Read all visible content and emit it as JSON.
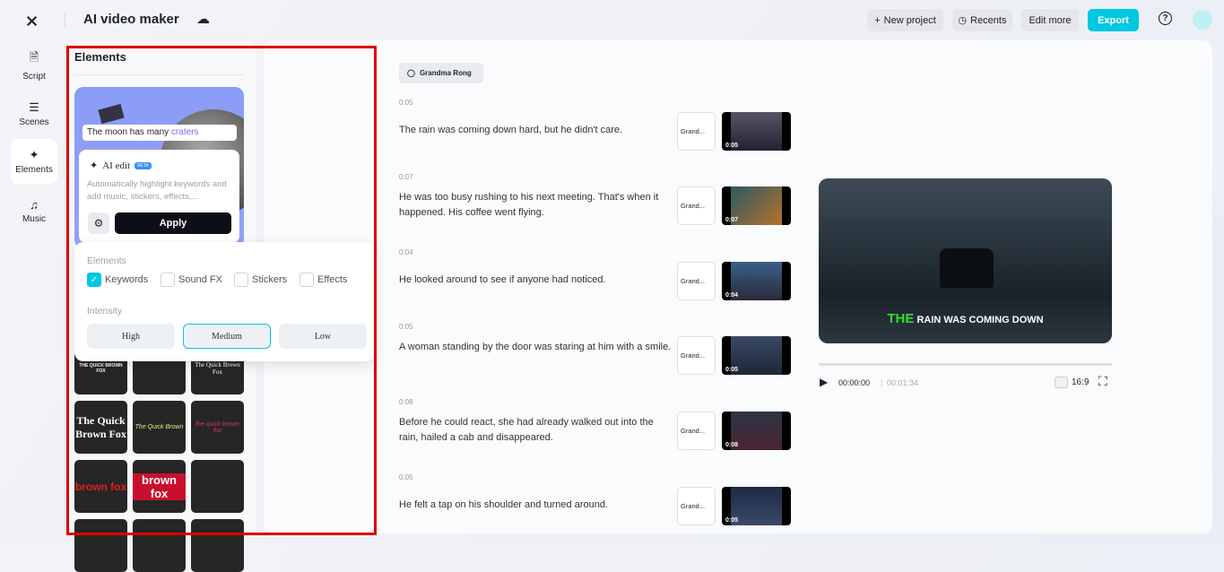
{
  "app": {
    "title": "AI video maker",
    "logo": "capcut-logo",
    "cloud_icon": "cloud-check-icon"
  },
  "toolbar": {
    "new_project": "New project",
    "recents": "Recents",
    "edit_more": "Edit more",
    "export": "Export",
    "accent": "#00c8e0"
  },
  "nav": [
    {
      "label": "Script",
      "icon": "script-icon"
    },
    {
      "label": "Scenes",
      "icon": "scenes-icon"
    },
    {
      "label": "Elements",
      "icon": "elements-icon",
      "active": true
    },
    {
      "label": "Music",
      "icon": "music-icon"
    }
  ],
  "elements_panel": {
    "title": "Elements",
    "hero_caption": "The moon has many ",
    "hero_keyword": "craters",
    "ai_edit": {
      "title": "AI edit",
      "badge": "BETA",
      "description": "Automatically highlight keywords and add music, stickers, effects,...",
      "apply": "Apply"
    },
    "popover": {
      "elements_label": "Elements",
      "options": [
        {
          "label": "Keywords",
          "checked": true
        },
        {
          "label": "Sound FX",
          "checked": false
        },
        {
          "label": "Stickers",
          "checked": false
        },
        {
          "label": "Effects",
          "checked": false
        }
      ],
      "intensity_label": "Intensity",
      "intensity": [
        "High",
        "Medium",
        "Low"
      ],
      "selected_intensity": "Medium"
    },
    "tiles": [
      "THE QUICK BROWN FOX",
      "",
      "The Quick Brown Fox",
      "The Quick Brown Fox",
      "The Quick Brown",
      "the quick brown fox",
      "brown fox",
      "brown fox",
      "",
      "",
      "",
      ""
    ]
  },
  "script": {
    "voice": "Grandma Rong",
    "scenes": [
      {
        "time": "0:05",
        "text": "The rain was coming down hard, but he didn't care.",
        "voice": "Grand...",
        "duration": "0:05"
      },
      {
        "time": "0:07",
        "text": "He was too busy rushing to his next meeting. That's when it happened. His coffee went flying.",
        "voice": "Grand...",
        "duration": "0:07"
      },
      {
        "time": "0:04",
        "text": "He looked around to see if anyone had noticed.",
        "voice": "Grand...",
        "duration": "0:04"
      },
      {
        "time": "0:05",
        "text": "A woman standing by the door was staring at him with a smile.",
        "voice": "Grand...",
        "duration": "0:05"
      },
      {
        "time": "0:08",
        "text": "Before he could react, she had already walked out into the rain, hailed a cab and disappeared.",
        "voice": "Grand...",
        "duration": "0:08"
      },
      {
        "time": "0:05",
        "text": "He felt a tap on his shoulder and turned around.",
        "voice": "Grand...",
        "duration": "0:05"
      }
    ]
  },
  "player": {
    "caption_keyword": "THE",
    "caption_rest": " RAIN WAS COMING DOWN",
    "current": "00:00:00",
    "total": "00:01:34",
    "aspect": "16:9",
    "progress": 0
  }
}
